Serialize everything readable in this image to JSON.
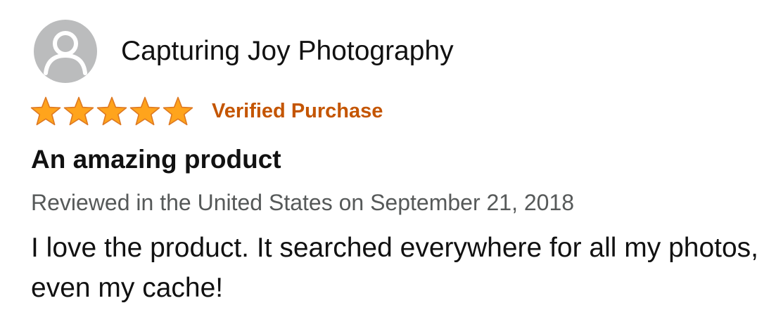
{
  "reviewer": {
    "name": "Capturing Joy Photography",
    "avatar_icon": "user-avatar-icon"
  },
  "rating": {
    "stars": 5,
    "max_stars": 5,
    "star_color": "#ffa41c",
    "star_outline": "#de7921"
  },
  "badge": {
    "label": "Verified Purchase",
    "color": "#c45500"
  },
  "review": {
    "title": "An amazing product",
    "meta": "Reviewed in the United States on September 21, 2018",
    "body": "I love the product. It searched everywhere for all my photos, even my cache!"
  }
}
